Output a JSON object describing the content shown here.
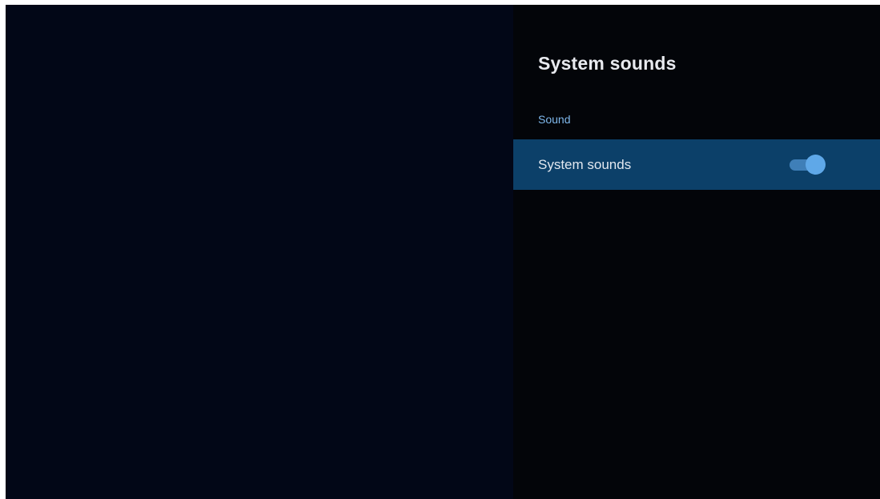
{
  "panel": {
    "title": "System sounds",
    "section_header": "Sound",
    "items": [
      {
        "label": "System sounds",
        "toggle_state": "on"
      }
    ]
  },
  "colors": {
    "background": "#030716",
    "panel_background": "#030509",
    "selected_row": "#0c4069",
    "accent": "#5fa8e8",
    "section_header": "#7fb8ec"
  },
  "icons": {
    "toggle": "toggle-switch-on"
  }
}
